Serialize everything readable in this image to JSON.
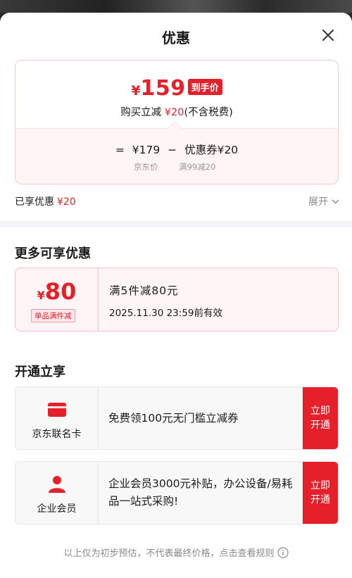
{
  "header": {
    "title": "优惠"
  },
  "price_card": {
    "currency": "¥",
    "final_price": "159",
    "final_tag": "到手价",
    "discount_prefix": "购买立减",
    "discount_amount": "¥20",
    "discount_suffix": "(不含税费)",
    "formula_eq": "=",
    "jd_price": "¥179",
    "formula_minus": "−",
    "coupon_part": "优惠券¥20",
    "jd_price_label": "京东价",
    "coupon_rule": "满99减20"
  },
  "enjoyed": {
    "label": "已享优惠",
    "amount": "¥20",
    "expand_label": "展开"
  },
  "more_offers": {
    "title": "更多可享优惠",
    "coupon": {
      "currency": "¥",
      "value": "80",
      "badge": "单品满件减",
      "rule": "满5件减80元",
      "expiry": "2025.11.30 23:59前有效"
    }
  },
  "open_benefits": {
    "title": "开通立享",
    "items": [
      {
        "name": "京东联名卡",
        "icon": "card-icon",
        "desc": "免费领100元无门槛立减券",
        "button": "立即开通"
      },
      {
        "name": "企业会员",
        "icon": "person-icon",
        "desc": "企业会员3000元补贴，办公设备/易耗品一站式采购!",
        "button": "立即开通"
      }
    ]
  },
  "footer": {
    "note": "以上仅为初步预估，不代表最终价格，点击查看规则"
  },
  "colors": {
    "accent": "#e4202b",
    "card_border": "#f9c9cf",
    "card_bg": "#fff5f6"
  }
}
